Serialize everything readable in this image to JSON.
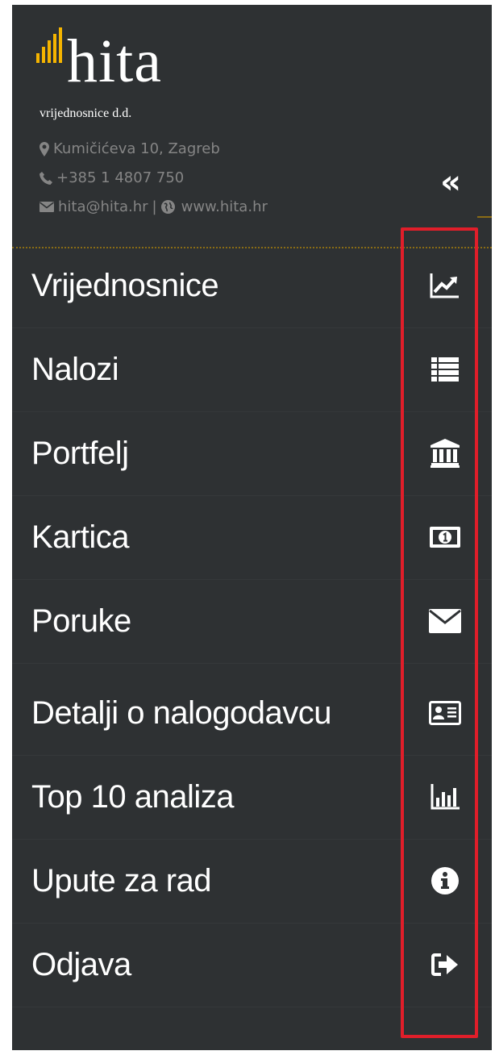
{
  "brand": {
    "name": "hita",
    "subtitle": "vrijednosnice d.d.",
    "accent_color": "#f5b400"
  },
  "contact": {
    "address": "Kumičićeva 10, Zagreb",
    "phone": "+385 1 4807 750",
    "email": "hita@hita.hr",
    "separator": "|",
    "website": "www.hita.hr"
  },
  "collapse": {
    "label": "«"
  },
  "menu": [
    {
      "label": "Vrijednosnice",
      "icon": "line-chart-icon"
    },
    {
      "label": "Nalozi",
      "icon": "list-icon"
    },
    {
      "label": "Portfelj",
      "icon": "bank-icon"
    },
    {
      "label": "Kartica",
      "icon": "money-icon"
    },
    {
      "label": "Poruke",
      "icon": "envelope-icon"
    },
    {
      "label": "Detalji o nalogodavcu",
      "icon": "id-card-icon"
    },
    {
      "label": "Top 10 analiza",
      "icon": "bar-chart-icon"
    },
    {
      "label": "Upute za rad",
      "icon": "info-circle-icon"
    },
    {
      "label": "Odjava",
      "icon": "sign-out-icon"
    }
  ],
  "highlight_color": "#e01e2a"
}
